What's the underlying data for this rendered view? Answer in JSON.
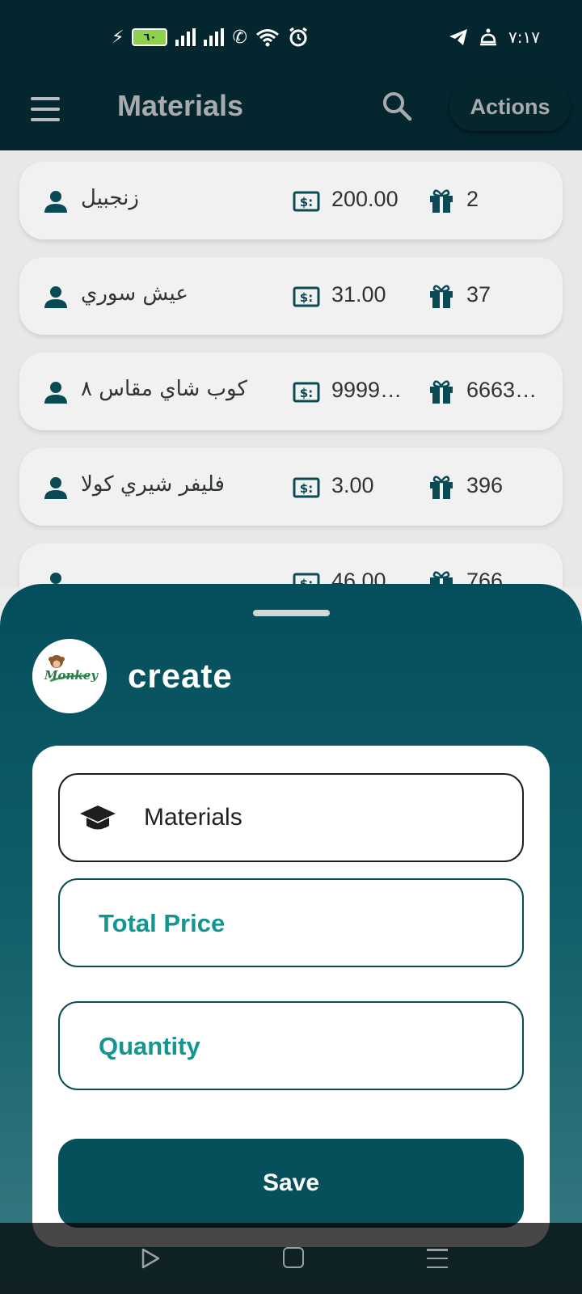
{
  "status_bar": {
    "battery_level": "٦٠",
    "time": "٧:١٧",
    "icons": [
      "charging-bolt-icon",
      "battery-icon",
      "signal-1-icon",
      "signal-2-icon",
      "wifi-calling-icon",
      "wifi-icon",
      "alarm-icon",
      "telegram-icon",
      "notification-icon"
    ]
  },
  "app_bar": {
    "title": "Materials",
    "actions_label": "Actions",
    "icons": [
      "menu-icon",
      "search-icon"
    ]
  },
  "materials": [
    {
      "name": "زنجبيل",
      "price": "200.00",
      "quantity": "2"
    },
    {
      "name": "عيش سوري",
      "price": "31.00",
      "quantity": "37"
    },
    {
      "name": "كوب شاي مقاس ٨",
      "price": "9999…",
      "quantity": "6663…"
    },
    {
      "name": "فليفر شيري كولا",
      "price": "3.00",
      "quantity": "396"
    },
    {
      "name": "",
      "price": "46.00",
      "quantity": "766"
    }
  ],
  "sheet": {
    "title": "create",
    "logo_text": "Monkey",
    "material_value": "Materials",
    "total_price_label": "Total Price",
    "quantity_label": "Quantity",
    "save_label": "Save"
  },
  "colors": {
    "app_bar_bg": "#04262e",
    "sheet_top": "#044e5b",
    "accent_teal": "#14958f",
    "save_bg": "#06505b"
  }
}
